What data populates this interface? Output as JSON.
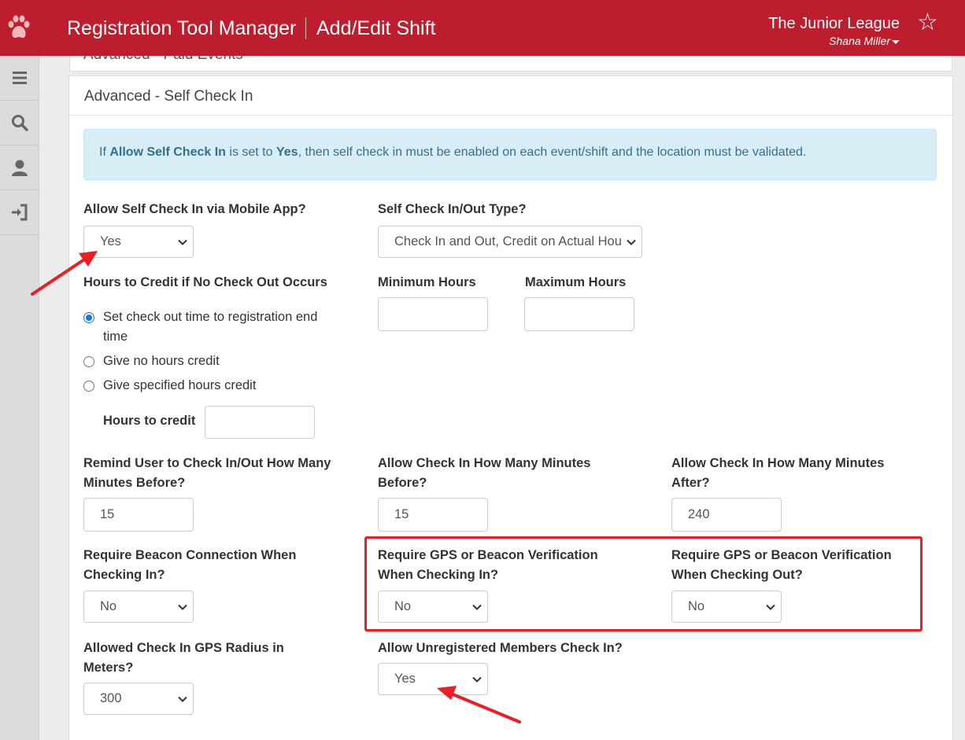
{
  "header": {
    "app_title": "Registration Tool Manager",
    "page_title": "Add/Edit Shift",
    "org_name": "The Junior League",
    "user_name": "Shana Miller"
  },
  "sidebar": {
    "items": [
      {
        "icon": "menu-icon"
      },
      {
        "icon": "search-icon"
      },
      {
        "icon": "user-icon"
      },
      {
        "icon": "sign-in-icon"
      }
    ]
  },
  "previous_panel": {
    "title": "Advanced - Paid Events"
  },
  "panel": {
    "title": "Advanced - Self Check In",
    "alert": {
      "prefix": "If ",
      "term1": "Allow Self Check In",
      "middle": " is set to ",
      "term2": "Yes",
      "suffix": ", then self check in must be enabled on each event/shift and the location must be validated."
    },
    "allow_mobile": {
      "label": "Allow Self Check In via Mobile App?",
      "value": "Yes"
    },
    "check_type": {
      "label": "Self Check In/Out Type?",
      "value": "Check In and Out, Credit on Actual Hours"
    },
    "hours_credit": {
      "label": "Hours to Credit if No Check Out Occurs",
      "options": [
        {
          "line1": "Set check out time to registration end",
          "line2": "time",
          "selected": true
        },
        {
          "line1": "Give no hours credit",
          "selected": false
        },
        {
          "line1": "Give specified hours credit",
          "selected": false
        }
      ],
      "hours_to_credit_label": "Hours to credit",
      "hours_to_credit_value": ""
    },
    "min_hours": {
      "label": "Minimum Hours",
      "value": ""
    },
    "max_hours": {
      "label": "Maximum Hours",
      "value": ""
    },
    "remind": {
      "line1": "Remind User to Check In/Out How Many",
      "line2": "Minutes Before?",
      "value": "15"
    },
    "allow_before": {
      "line1": "Allow Check In How Many Minutes",
      "line2": "Before?",
      "value": "15"
    },
    "allow_after": {
      "line1": "Allow Check In How Many Minutes",
      "line2": "After?",
      "value": "240"
    },
    "beacon": {
      "line1": "Require Beacon Connection When",
      "line2": "Checking In?",
      "value": "No"
    },
    "gps_in": {
      "line1": "Require GPS or Beacon Verification",
      "line2": "When Checking In?",
      "value": "No"
    },
    "gps_out": {
      "line1": "Require GPS or Beacon Verification",
      "line2": "When Checking Out?",
      "value": "No"
    },
    "radius": {
      "line1": "Allowed Check In GPS Radius in",
      "line2": "Meters?",
      "value": "300"
    },
    "unregistered": {
      "label": "Allow Unregistered Members Check In?",
      "value": "Yes"
    }
  },
  "colors": {
    "brand": "#bd1e2e",
    "alert_bg": "#d9edf7",
    "highlight": "#ee1c25"
  }
}
